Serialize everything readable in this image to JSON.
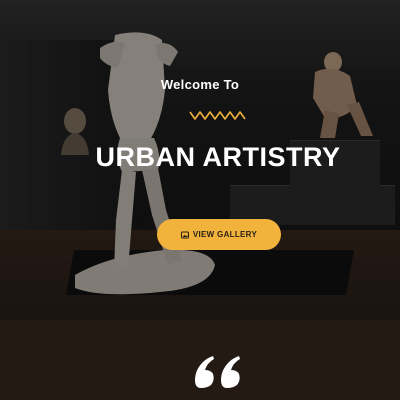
{
  "hero": {
    "welcome": "Welcome To",
    "title": "URBAN ARTISTRY",
    "cta_label": "VIEW GALLERY",
    "cta_icon": "gallery-icon",
    "divider_icon": "zigzag-divider-icon"
  },
  "testimonial": {
    "quote_icon": "quote-icon"
  },
  "colors": {
    "accent": "#f2b33d",
    "band_bg": "#241a14",
    "text": "#ffffff"
  }
}
